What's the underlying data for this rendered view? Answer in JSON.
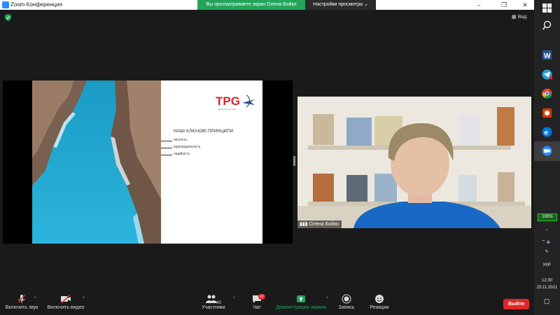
{
  "window": {
    "title": "Zoom Конференция"
  },
  "share_banner": "Вы просматриваете экран Олена Бойко",
  "view_options": "Настройки просмотра",
  "view_button": "Вид",
  "slide": {
    "logo": "TPG",
    "logo_sub": "Дніпровська група",
    "heading": "НАШІ КЛЮЧОВІ ПРИНЦИПИ:",
    "items": [
      "чесність",
      "відповідальність",
      "надійність"
    ]
  },
  "participant": {
    "name": "Олена Бойко"
  },
  "toolbar": {
    "audio": "Включить звук",
    "video": "Включить видео",
    "participants": "Участники",
    "participants_count": "60",
    "chat": "Чат",
    "chat_badge": "12",
    "share": "Демонстрация экрана",
    "record": "Запись",
    "reactions": "Реакции",
    "leave": "Выйти"
  },
  "taskbar": {
    "battery": "100%",
    "lang": "УКР",
    "time": "12:30",
    "date": "23.11.2021"
  },
  "colors": {
    "accent_green": "#23a55a",
    "leave_red": "#e02828",
    "zoom_blue": "#2d8cff"
  }
}
